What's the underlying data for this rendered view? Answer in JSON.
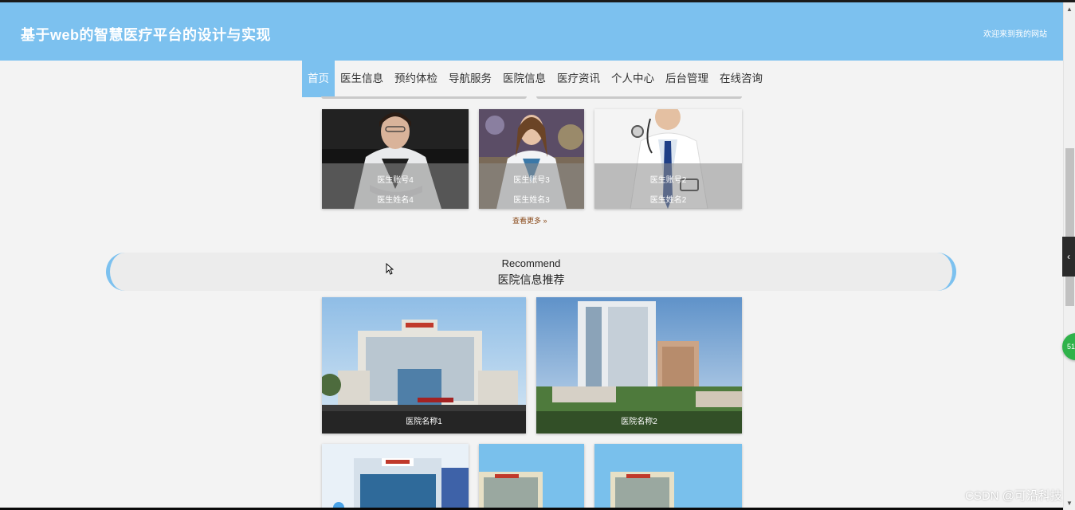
{
  "header": {
    "title": "基于web的智慧医疗平台的设计与实现",
    "welcome": "欢迎来到我的网站"
  },
  "nav": {
    "items": [
      "首页",
      "医生信息",
      "预约体检",
      "导航服务",
      "医院信息",
      "医疗资讯",
      "个人中心",
      "后台管理",
      "在线咨询"
    ],
    "active_index": 0
  },
  "doctors": [
    {
      "account": "医生账号4",
      "name": "医生姓名4"
    },
    {
      "account": "医生账号3",
      "name": "医生姓名3"
    },
    {
      "account": "医生账号2",
      "name": "医生姓名2"
    }
  ],
  "doctors_more": "查看更多",
  "recommend": {
    "english": "Recommend",
    "chinese": "医院信息推荐"
  },
  "hospitals": [
    {
      "name": "医院名称1"
    },
    {
      "name": "医院名称2"
    }
  ],
  "watermark": "CSDN @可沿科技",
  "badge_text": "51",
  "colors": {
    "header_bg": "#7cc1ef",
    "page_bg": "#f3f3f3",
    "banner_bg": "#ececec"
  }
}
